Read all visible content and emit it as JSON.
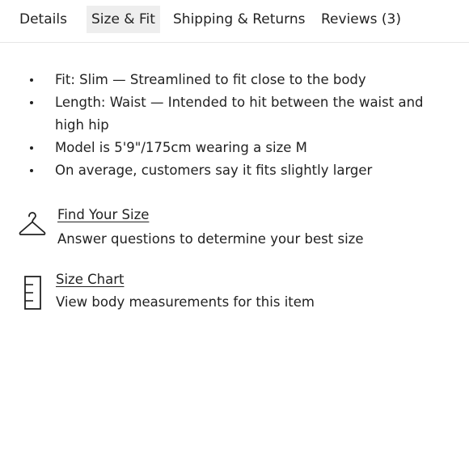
{
  "tabs": [
    {
      "label": "Details",
      "active": false
    },
    {
      "label": "Size & Fit",
      "active": true
    },
    {
      "label": "Shipping & Returns",
      "active": false
    },
    {
      "label": "Reviews (3)",
      "active": false
    }
  ],
  "fit_details": [
    "Fit: Slim — Streamlined to fit close to the body",
    "Length: Waist — Intended to hit between the waist and high hip",
    "Model is 5'9\"/175cm wearing a size M",
    "On average, customers say it fits slightly larger"
  ],
  "find_your_size": {
    "icon": "hanger-icon",
    "link_label": "Find Your Size",
    "description": "Answer questions to determine your best size"
  },
  "size_chart": {
    "icon": "ruler-icon",
    "link_label": "Size Chart",
    "description": "View body measurements for this item"
  },
  "colors": {
    "text": "#222222",
    "active_tab_bg": "#eeeeee",
    "divider": "#e6e6e6"
  }
}
